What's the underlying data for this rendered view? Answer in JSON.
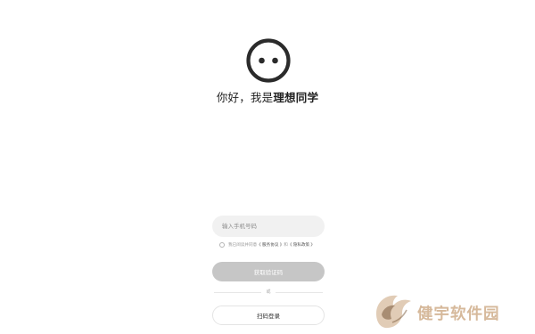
{
  "header": {
    "greeting_prefix": "你好，我是",
    "brand_name": "理想同学"
  },
  "login": {
    "phone_placeholder": "输入手机号码",
    "agreement_prefix": "我已阅读并同意",
    "user_agreement": "《 服务协议 》",
    "agreement_and": "和",
    "privacy_policy": "《 隐私政策 》",
    "get_code_label": "获取验证码",
    "or_label": "或",
    "scan_login_label": "扫码登录"
  },
  "watermark": {
    "text": "健宇软件园"
  },
  "colors": {
    "logo": "#2b2b2b",
    "input_bg": "#f1f1f1",
    "button_disabled_bg": "#c6c6c6",
    "watermark": "#c9a27a"
  },
  "icons": {
    "logo": "face-logo-icon",
    "checkbox": "radio-check-icon",
    "watermark": "fox-logo-icon"
  }
}
